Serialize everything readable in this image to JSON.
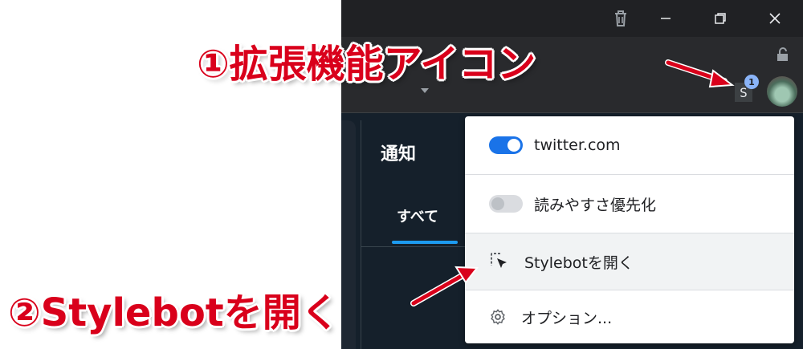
{
  "browser": {
    "titlebar_icons": [
      "trash-icon",
      "minimize-icon",
      "restore-icon",
      "close-icon"
    ],
    "extension_badge": "S",
    "extension_badge_count": "1"
  },
  "twitter": {
    "notifications_title": "通知",
    "tab_all": "すべて"
  },
  "ext_menu": {
    "site_toggle_label": "twitter.com",
    "site_toggle_on": true,
    "readability_label": "読みやすさ優先化",
    "readability_on": false,
    "open_label": "Stylebotを開く",
    "options_label": "オプション..."
  },
  "annotations": {
    "label1": "①拡張機能アイコン",
    "label2": "②Stylebotを開く",
    "color": "#d9001b"
  }
}
